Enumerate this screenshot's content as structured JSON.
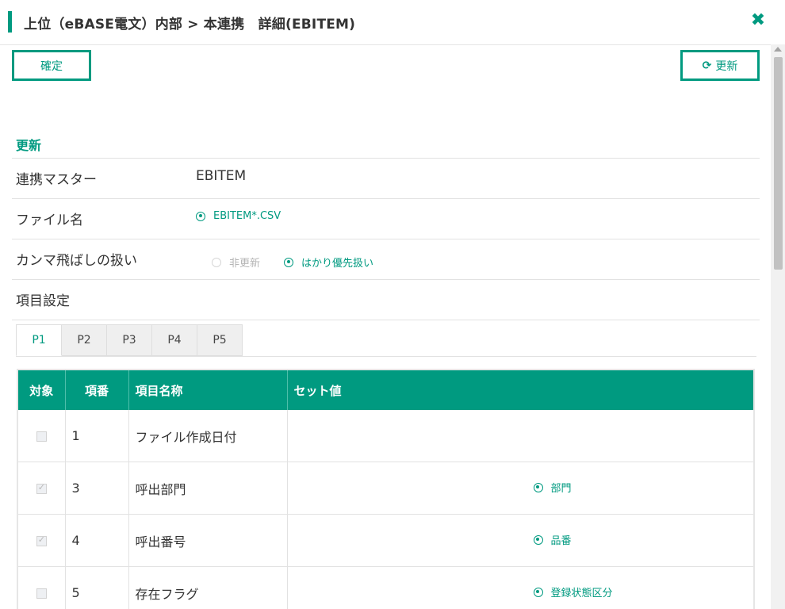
{
  "header": {
    "title": "上位（eBASE電文）内部 > 本連携　詳細(EBITEM)",
    "close_icon": "close-icon"
  },
  "toolbar": {
    "confirm_label": "確定",
    "refresh_label": "更新",
    "refresh_icon": "refresh-icon"
  },
  "section": {
    "title": "更新"
  },
  "fields": {
    "master": {
      "label": "連携マスター",
      "value": "EBITEM"
    },
    "filename": {
      "label": "ファイル名",
      "option": "EBITEM*.CSV"
    },
    "comma": {
      "label": "カンマ飛ばしの扱い",
      "options": [
        {
          "label": "非更新",
          "selected": false,
          "disabled": true
        },
        {
          "label": "はかり優先扱い",
          "selected": true,
          "disabled": false
        }
      ]
    },
    "items": {
      "label": "項目設定"
    }
  },
  "tabs": [
    "P1",
    "P2",
    "P3",
    "P4",
    "P5"
  ],
  "active_tab": "P1",
  "table": {
    "columns": [
      "対象",
      "項番",
      "項目名称",
      "セット値"
    ],
    "rows": [
      {
        "checked": false,
        "no": "1",
        "name": "ファイル作成日付",
        "set_value": ""
      },
      {
        "checked": true,
        "no": "3",
        "name": "呼出部門",
        "set_value": "部門"
      },
      {
        "checked": true,
        "no": "4",
        "name": "呼出番号",
        "set_value": "品番"
      },
      {
        "checked": false,
        "no": "5",
        "name": "存在フラグ",
        "set_value": "登録状態区分"
      }
    ]
  },
  "colors": {
    "accent": "#009a80",
    "header_bg": "#ffffff"
  }
}
